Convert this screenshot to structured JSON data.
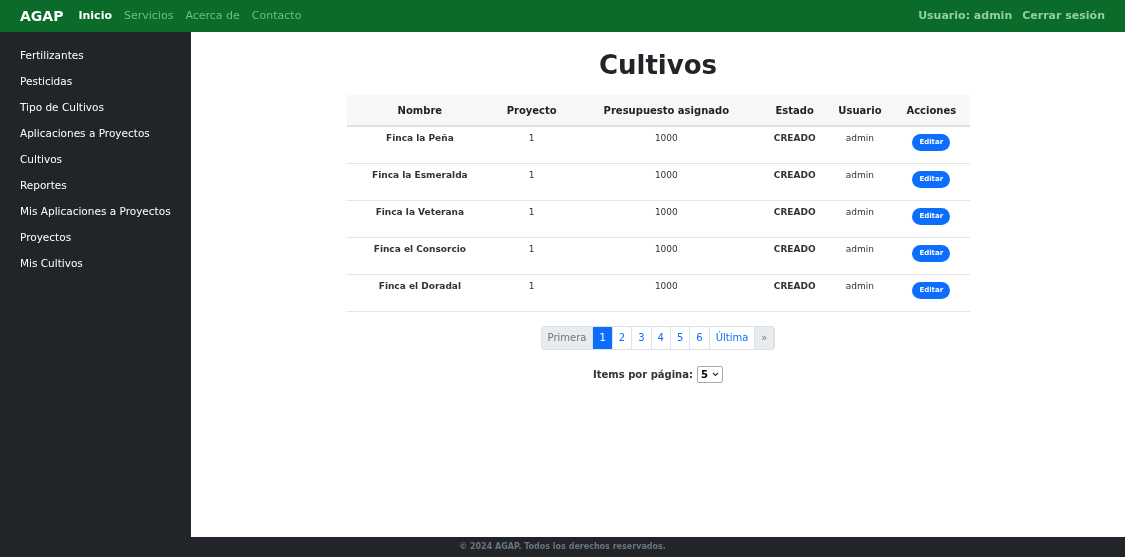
{
  "navbar": {
    "brand": "AGAP",
    "links": [
      {
        "label": "Inicio",
        "selected": true
      },
      {
        "label": "Servicios",
        "selected": false
      },
      {
        "label": "Acerca de",
        "selected": false
      },
      {
        "label": "Contacto",
        "selected": false
      }
    ],
    "user": "Usuario: admin",
    "logout": "Cerrar sesión"
  },
  "sidebar": {
    "items": [
      "Fertilizantes",
      "Pesticidas",
      "Tipo de Cultivos",
      "Aplicaciones a Proyectos",
      "Cultivos",
      "Reportes",
      "Mis Aplicaciones a Proyectos",
      "Proyectos",
      "Mis Cultivos"
    ]
  },
  "page_title": "Cultivos",
  "table": {
    "columns": [
      "Nombre",
      "Proyecto",
      "Presupuesto asignado",
      "Estado",
      "Usuario",
      "Acciones"
    ],
    "rows": [
      {
        "nombre": "Finca la Peña",
        "proyecto": "1",
        "presupuesto": "1000",
        "estado": "CREADO",
        "usuario": "admin",
        "action": "Editar"
      },
      {
        "nombre": "Finca la Esmeralda",
        "proyecto": "1",
        "presupuesto": "1000",
        "estado": "CREADO",
        "usuario": "admin",
        "action": "Editar"
      },
      {
        "nombre": "Finca la Veterana",
        "proyecto": "1",
        "presupuesto": "1000",
        "estado": "CREADO",
        "usuario": "admin",
        "action": "Editar"
      },
      {
        "nombre": "Finca el Consorcio",
        "proyecto": "1",
        "presupuesto": "1000",
        "estado": "CREADO",
        "usuario": "admin",
        "action": "Editar"
      },
      {
        "nombre": "Finca el Doradal",
        "proyecto": "1",
        "presupuesto": "1000",
        "estado": "CREADO",
        "usuario": "admin",
        "action": "Editar"
      }
    ]
  },
  "pagination": [
    {
      "label": "Primera",
      "selected": false,
      "disabled": true
    },
    {
      "label": "1",
      "selected": true,
      "disabled": false
    },
    {
      "label": "2",
      "selected": false,
      "disabled": false
    },
    {
      "label": "3",
      "selected": false,
      "disabled": false
    },
    {
      "label": "4",
      "selected": false,
      "disabled": false
    },
    {
      "label": "5",
      "selected": false,
      "disabled": false
    },
    {
      "label": "6",
      "selected": false,
      "disabled": false
    },
    {
      "label": "Última",
      "selected": false,
      "disabled": false
    },
    {
      "label": "»",
      "selected": false,
      "disabled": true
    }
  ],
  "items_per_page": {
    "label": "Items por página:",
    "value": "5"
  },
  "footer": "© 2024 AGAP. Todos los derechos reservados."
}
